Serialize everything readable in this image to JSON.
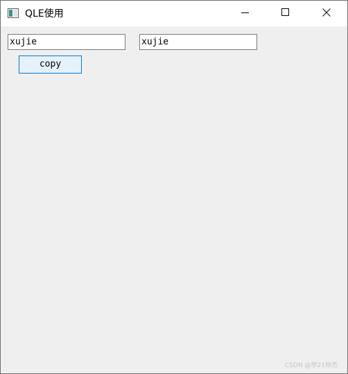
{
  "window": {
    "title": "QLE使用",
    "icon": "qt-window-icon"
  },
  "title_buttons": {
    "minimize_icon": "minimize-icon",
    "maximize_icon": "maximize-icon",
    "close_icon": "close-icon"
  },
  "inputs": [
    {
      "value": "xujie"
    },
    {
      "value": "xujie"
    }
  ],
  "copy_button": {
    "label": "copy"
  },
  "watermark": "CSDN @学21帅杰",
  "colors": {
    "window_bg": "#efefef",
    "titlebar_bg": "#ffffff",
    "button_border": "#0078d7",
    "button_bg": "#e5f1fb",
    "input_border": "#7a7a7a"
  }
}
